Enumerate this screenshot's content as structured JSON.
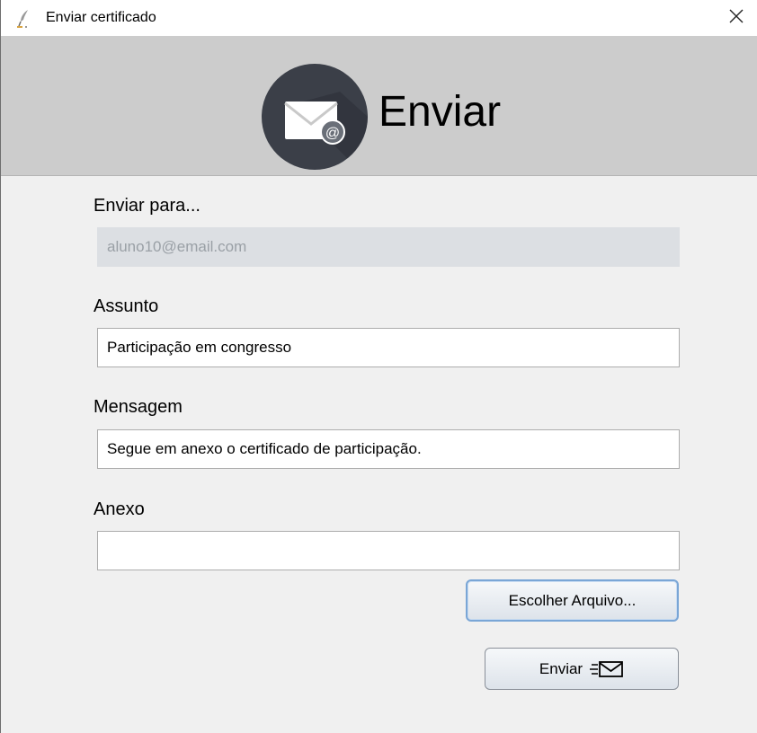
{
  "window": {
    "title": "Enviar certificado",
    "close_label": "×",
    "app_icon": "feather-pen-icon"
  },
  "header": {
    "title": "Enviar",
    "logo_icon": "envelope-at-icon",
    "logo_badge": "@"
  },
  "form": {
    "to": {
      "label": "Enviar para...",
      "value": "aluno10@email.com",
      "disabled": true
    },
    "subject": {
      "label": "Assunto",
      "value": "Participação em congresso"
    },
    "message": {
      "label": "Mensagem",
      "value": "Segue em anexo o certificado de participação."
    },
    "attachment": {
      "label": "Anexo",
      "value": ""
    }
  },
  "buttons": {
    "choose_file": "Escolher Arquivo...",
    "send": "Enviar",
    "send_icon": "send-mail-icon"
  },
  "colors": {
    "header_bg": "#cccccc",
    "logo_circle": "#3b3f48",
    "window_bg": "#f0f0f0",
    "disabled_field_bg": "#dcdfe3"
  }
}
